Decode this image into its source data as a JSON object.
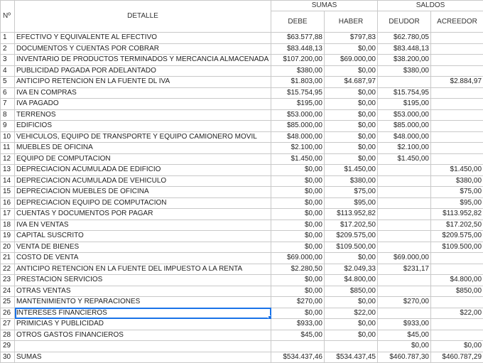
{
  "headers": {
    "num": "Nº",
    "detalle": "DETALLE",
    "sumas": "SUMAS",
    "saldos": "SALDOS",
    "debe": "DEBE",
    "haber": "HABER",
    "deudor": "DEUDOR",
    "acreedor": "ACREEDOR"
  },
  "rows": [
    {
      "n": "1",
      "detalle": "EFECTIVO Y EQUIVALENTE AL EFECTIVO",
      "debe": "$63.577,88",
      "haber": "$797,83",
      "deudor": "$62.780,05",
      "acreedor": ""
    },
    {
      "n": "2",
      "detalle": "DOCUMENTOS Y CUENTAS POR COBRAR",
      "debe": "$83.448,13",
      "haber": "$0,00",
      "deudor": "$83.448,13",
      "acreedor": ""
    },
    {
      "n": "3",
      "detalle": "INVENTARIO DE PRODUCTOS TERMINADOS Y MERCANCIA ALMACENADA",
      "debe": "$107.200,00",
      "haber": "$69.000,00",
      "deudor": "$38.200,00",
      "acreedor": ""
    },
    {
      "n": "4",
      "detalle": "PUBLICIDAD PAGADA POR ADELANTADO",
      "debe": "$380,00",
      "haber": "$0,00",
      "deudor": "$380,00",
      "acreedor": ""
    },
    {
      "n": "5",
      "detalle": "ANTICIPO RETENCION EN LA FUENTE DL IVA",
      "debe": "$1.803,00",
      "haber": "$4.687,97",
      "deudor": "",
      "acreedor": "$2.884,97"
    },
    {
      "n": "6",
      "detalle": "IVA EN COMPRAS",
      "debe": "$15.754,95",
      "haber": "$0,00",
      "deudor": "$15.754,95",
      "acreedor": ""
    },
    {
      "n": "7",
      "detalle": "IVA PAGADO",
      "debe": "$195,00",
      "haber": "$0,00",
      "deudor": "$195,00",
      "acreedor": ""
    },
    {
      "n": "8",
      "detalle": "TERRENOS",
      "debe": "$53.000,00",
      "haber": "$0,00",
      "deudor": "$53.000,00",
      "acreedor": ""
    },
    {
      "n": "9",
      "detalle": "EDIFICIOS",
      "debe": "$85.000,00",
      "haber": "$0,00",
      "deudor": "$85.000,00",
      "acreedor": ""
    },
    {
      "n": "10",
      "detalle": "VEHICULOS, EQUIPO DE TRANSPORTE Y EQUIPO CAMIONERO MOVIL",
      "debe": "$48.000,00",
      "haber": "$0,00",
      "deudor": "$48.000,00",
      "acreedor": ""
    },
    {
      "n": "11",
      "detalle": "MUEBLES DE OFICINA",
      "debe": "$2.100,00",
      "haber": "$0,00",
      "deudor": "$2.100,00",
      "acreedor": ""
    },
    {
      "n": "12",
      "detalle": "EQUIPO DE COMPUTACION",
      "debe": "$1.450,00",
      "haber": "$0,00",
      "deudor": "$1.450,00",
      "acreedor": ""
    },
    {
      "n": "13",
      "detalle": "DEPRECIACION ACUMULADA DE EDIFICIO",
      "debe": "$0,00",
      "haber": "$1.450,00",
      "deudor": "",
      "acreedor": "$1.450,00"
    },
    {
      "n": "14",
      "detalle": "DEPRECIACION ACUMULADA DE VEHICULO",
      "debe": "$0,00",
      "haber": "$380,00",
      "deudor": "",
      "acreedor": "$380,00"
    },
    {
      "n": "15",
      "detalle": "DEPRECIACION MUEBLES DE OFICINA",
      "debe": "$0,00",
      "haber": "$75,00",
      "deudor": "",
      "acreedor": "$75,00"
    },
    {
      "n": "16",
      "detalle": "DEPRECIACION EQUIPO DE COMPUTACION",
      "debe": "$0,00",
      "haber": "$95,00",
      "deudor": "",
      "acreedor": "$95,00"
    },
    {
      "n": "17",
      "detalle": "CUENTAS Y DOCUMENTOS POR PAGAR",
      "debe": "$0,00",
      "haber": "$113.952,82",
      "deudor": "",
      "acreedor": "$113.952,82"
    },
    {
      "n": "18",
      "detalle": "IVA EN VENTAS",
      "debe": "$0,00",
      "haber": "$17.202,50",
      "deudor": "",
      "acreedor": "$17.202,50"
    },
    {
      "n": "19",
      "detalle": "CAPITAL SUSCRITO",
      "debe": "$0,00",
      "haber": "$209.575,00",
      "deudor": "",
      "acreedor": "$209.575,00"
    },
    {
      "n": "20",
      "detalle": "VENTA DE BIENES",
      "debe": "$0,00",
      "haber": "$109.500,00",
      "deudor": "",
      "acreedor": "$109.500,00"
    },
    {
      "n": "21",
      "detalle": "COSTO DE VENTA",
      "debe": "$69.000,00",
      "haber": "$0,00",
      "deudor": "$69.000,00",
      "acreedor": ""
    },
    {
      "n": "22",
      "detalle": "ANTICIPO RETENCION EN LA FUENTE DEL IMPUESTO A LA RENTA",
      "debe": "$2.280,50",
      "haber": "$2.049,33",
      "deudor": "$231,17",
      "acreedor": ""
    },
    {
      "n": "23",
      "detalle": "PRESTACION SERVICIOS",
      "debe": "$0,00",
      "haber": "$4.800,00",
      "deudor": "",
      "acreedor": "$4.800,00"
    },
    {
      "n": "24",
      "detalle": "OTRAS VENTAS",
      "debe": "$0,00",
      "haber": "$850,00",
      "deudor": "",
      "acreedor": "$850,00"
    },
    {
      "n": "25",
      "detalle": "MANTENIMIENTO Y REPARACIONES",
      "debe": "$270,00",
      "haber": "$0,00",
      "deudor": "$270,00",
      "acreedor": ""
    },
    {
      "n": "26",
      "detalle": "INTERESES FINANCIEROS",
      "debe": "$0,00",
      "haber": "$22,00",
      "deudor": "",
      "acreedor": "$22,00"
    },
    {
      "n": "27",
      "detalle": "PRIMICIAS Y PUBLICIDAD",
      "debe": "$933,00",
      "haber": "$0,00",
      "deudor": "$933,00",
      "acreedor": ""
    },
    {
      "n": "28",
      "detalle": "OTROS GASTOS FINANCIEROS",
      "debe": "$45,00",
      "haber": "$0,00",
      "deudor": "$45,00",
      "acreedor": ""
    },
    {
      "n": "29",
      "detalle": "",
      "debe": "",
      "haber": "",
      "deudor": "$0,00",
      "acreedor": "$0,00"
    },
    {
      "n": "30",
      "detalle": "SUMAS",
      "debe": "$534.437,46",
      "haber": "$534.437,45",
      "deudor": "$460.787,30",
      "acreedor": "$460.787,29"
    }
  ],
  "selection": {
    "row": 26,
    "column": "detalle"
  },
  "colors": {
    "selection": "#1a73e8",
    "grid": "#c9c9c9"
  }
}
